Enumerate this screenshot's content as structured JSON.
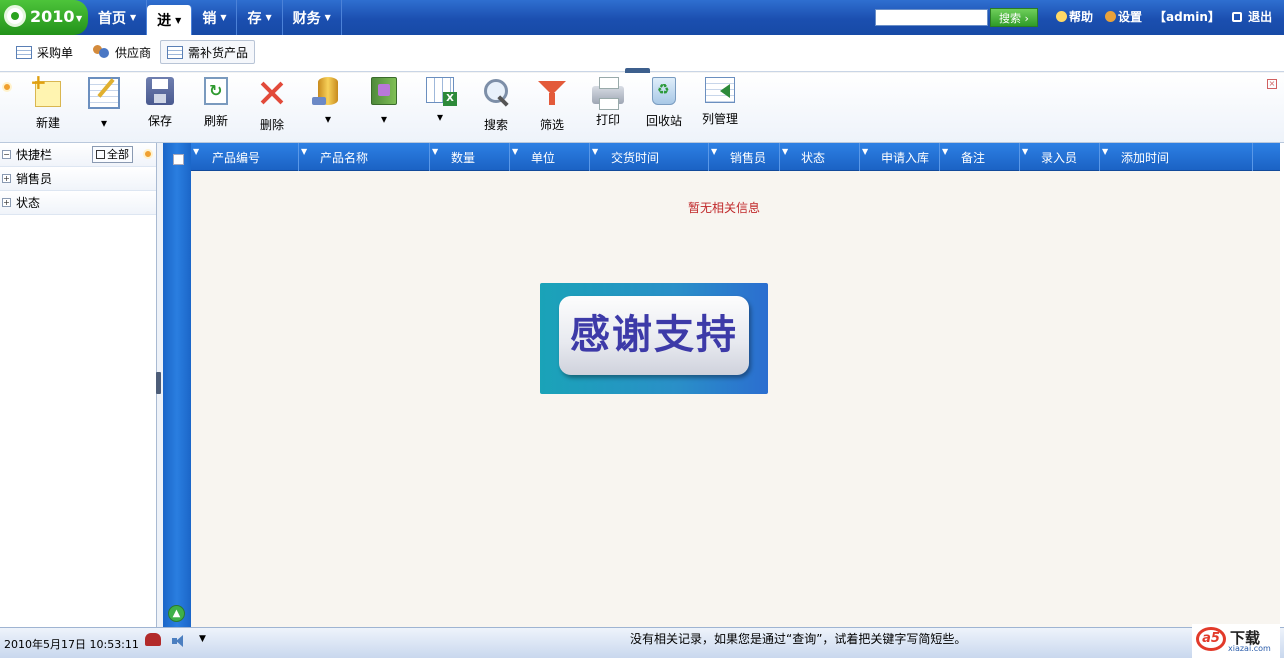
{
  "logo": {
    "text": "2010"
  },
  "nav": {
    "items": [
      {
        "label": "首页",
        "active": false
      },
      {
        "label": "进",
        "active": true
      },
      {
        "label": "销",
        "active": false
      },
      {
        "label": "存",
        "active": false
      },
      {
        "label": "财务",
        "active": false
      }
    ],
    "search_button": "搜索",
    "search_value": "",
    "help": "帮助",
    "settings": "设置",
    "user": "【admin】",
    "logout": "退出"
  },
  "subtabs": [
    {
      "label": "采购单",
      "icon": "table-icon",
      "active": false
    },
    {
      "label": "供应商",
      "icon": "people-icon",
      "active": false
    },
    {
      "label": "需补货产品",
      "icon": "table-icon",
      "active": true
    }
  ],
  "toolbar": {
    "buttons": [
      {
        "label": "新建",
        "icon": "new-icon"
      },
      {
        "label": "▾",
        "icon": "edit-icon"
      },
      {
        "label": "保存",
        "icon": "save-icon"
      },
      {
        "label": "刷新",
        "icon": "refresh-icon"
      },
      {
        "label": "删除",
        "icon": "delete-icon"
      },
      {
        "label": "▾",
        "icon": "database-icon"
      },
      {
        "label": "▾",
        "icon": "book-icon"
      },
      {
        "label": "▾",
        "icon": "excel-icon"
      },
      {
        "label": "搜索",
        "icon": "search-icon"
      },
      {
        "label": "筛选",
        "icon": "filter-icon"
      },
      {
        "label": "打印",
        "icon": "print-icon"
      },
      {
        "label": "回收站",
        "icon": "recycle-bin-icon"
      },
      {
        "label": "列管理",
        "icon": "column-manage-icon"
      }
    ]
  },
  "leftpanel": {
    "title": "快捷栏",
    "all_button": "全部",
    "items": [
      "销售员",
      "状态"
    ]
  },
  "grid": {
    "columns": [
      "产品编号",
      "产品名称",
      "数量",
      "单位",
      "交货时间",
      "销售员",
      "状态",
      "申请入库",
      "备注",
      "录入员",
      "添加时间"
    ],
    "empty_message": "暂无相关信息",
    "thanks_banner": "感谢支持"
  },
  "statusbar": {
    "datetime": "2010年5月17日  10:53:11",
    "message": "没有相关记录，如果您是通过“查询”，试着把关键字写简短些。",
    "logo_text": "下载",
    "logo_site": "xiazai.com"
  },
  "colors": {
    "nav_bg": "#1b4fb0",
    "grid_header": "#2d80e4",
    "empty_text": "#c0282a",
    "banner_text": "#3d3aa8"
  }
}
